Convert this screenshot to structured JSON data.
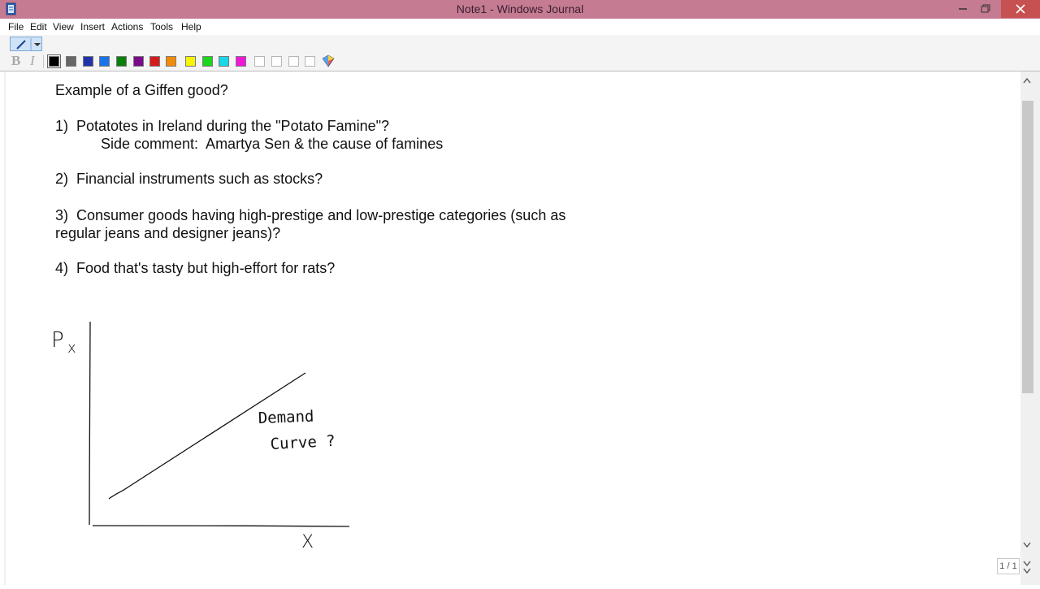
{
  "window": {
    "title": "Note1 - Windows Journal"
  },
  "menu": [
    "File",
    "Edit",
    "View",
    "Insert",
    "Actions",
    "Tools",
    "Help"
  ],
  "toolbar": {
    "format": {
      "bold": "B",
      "italic": "I"
    },
    "colors": [
      "#000000",
      "#666666",
      "#2233aa",
      "#1a73e8",
      "#0a7f0a",
      "#7a0a8a",
      "#d61b1b",
      "#f08b0b",
      "#f7f40a",
      "#1bd61b",
      "#1bd6e6",
      "#ef18d6",
      "#ffffff",
      "#ffffff",
      "#ffffff",
      "#ffffff"
    ]
  },
  "document": {
    "lines": [
      "Example of a Giffen good?",
      "1)  Potatotes in Ireland during the \"Potato Famine\"?",
      "Side comment:  Amartya Sen & the cause of famines",
      "2)  Financial instruments such as stocks?",
      "3)  Consumer goods having high-prestige and low-prestige categories (such as",
      "regular jeans and designer jeans)?",
      "4)  Food that's tasty but high-effort for rats?"
    ],
    "sketch": {
      "y_axis_label": "P",
      "y_axis_subscript": "x",
      "x_axis_label": "X",
      "curve_label_line1": "Demand",
      "curve_label_line2": "Curve ?"
    }
  },
  "status": {
    "page_count": "1 / 1"
  }
}
